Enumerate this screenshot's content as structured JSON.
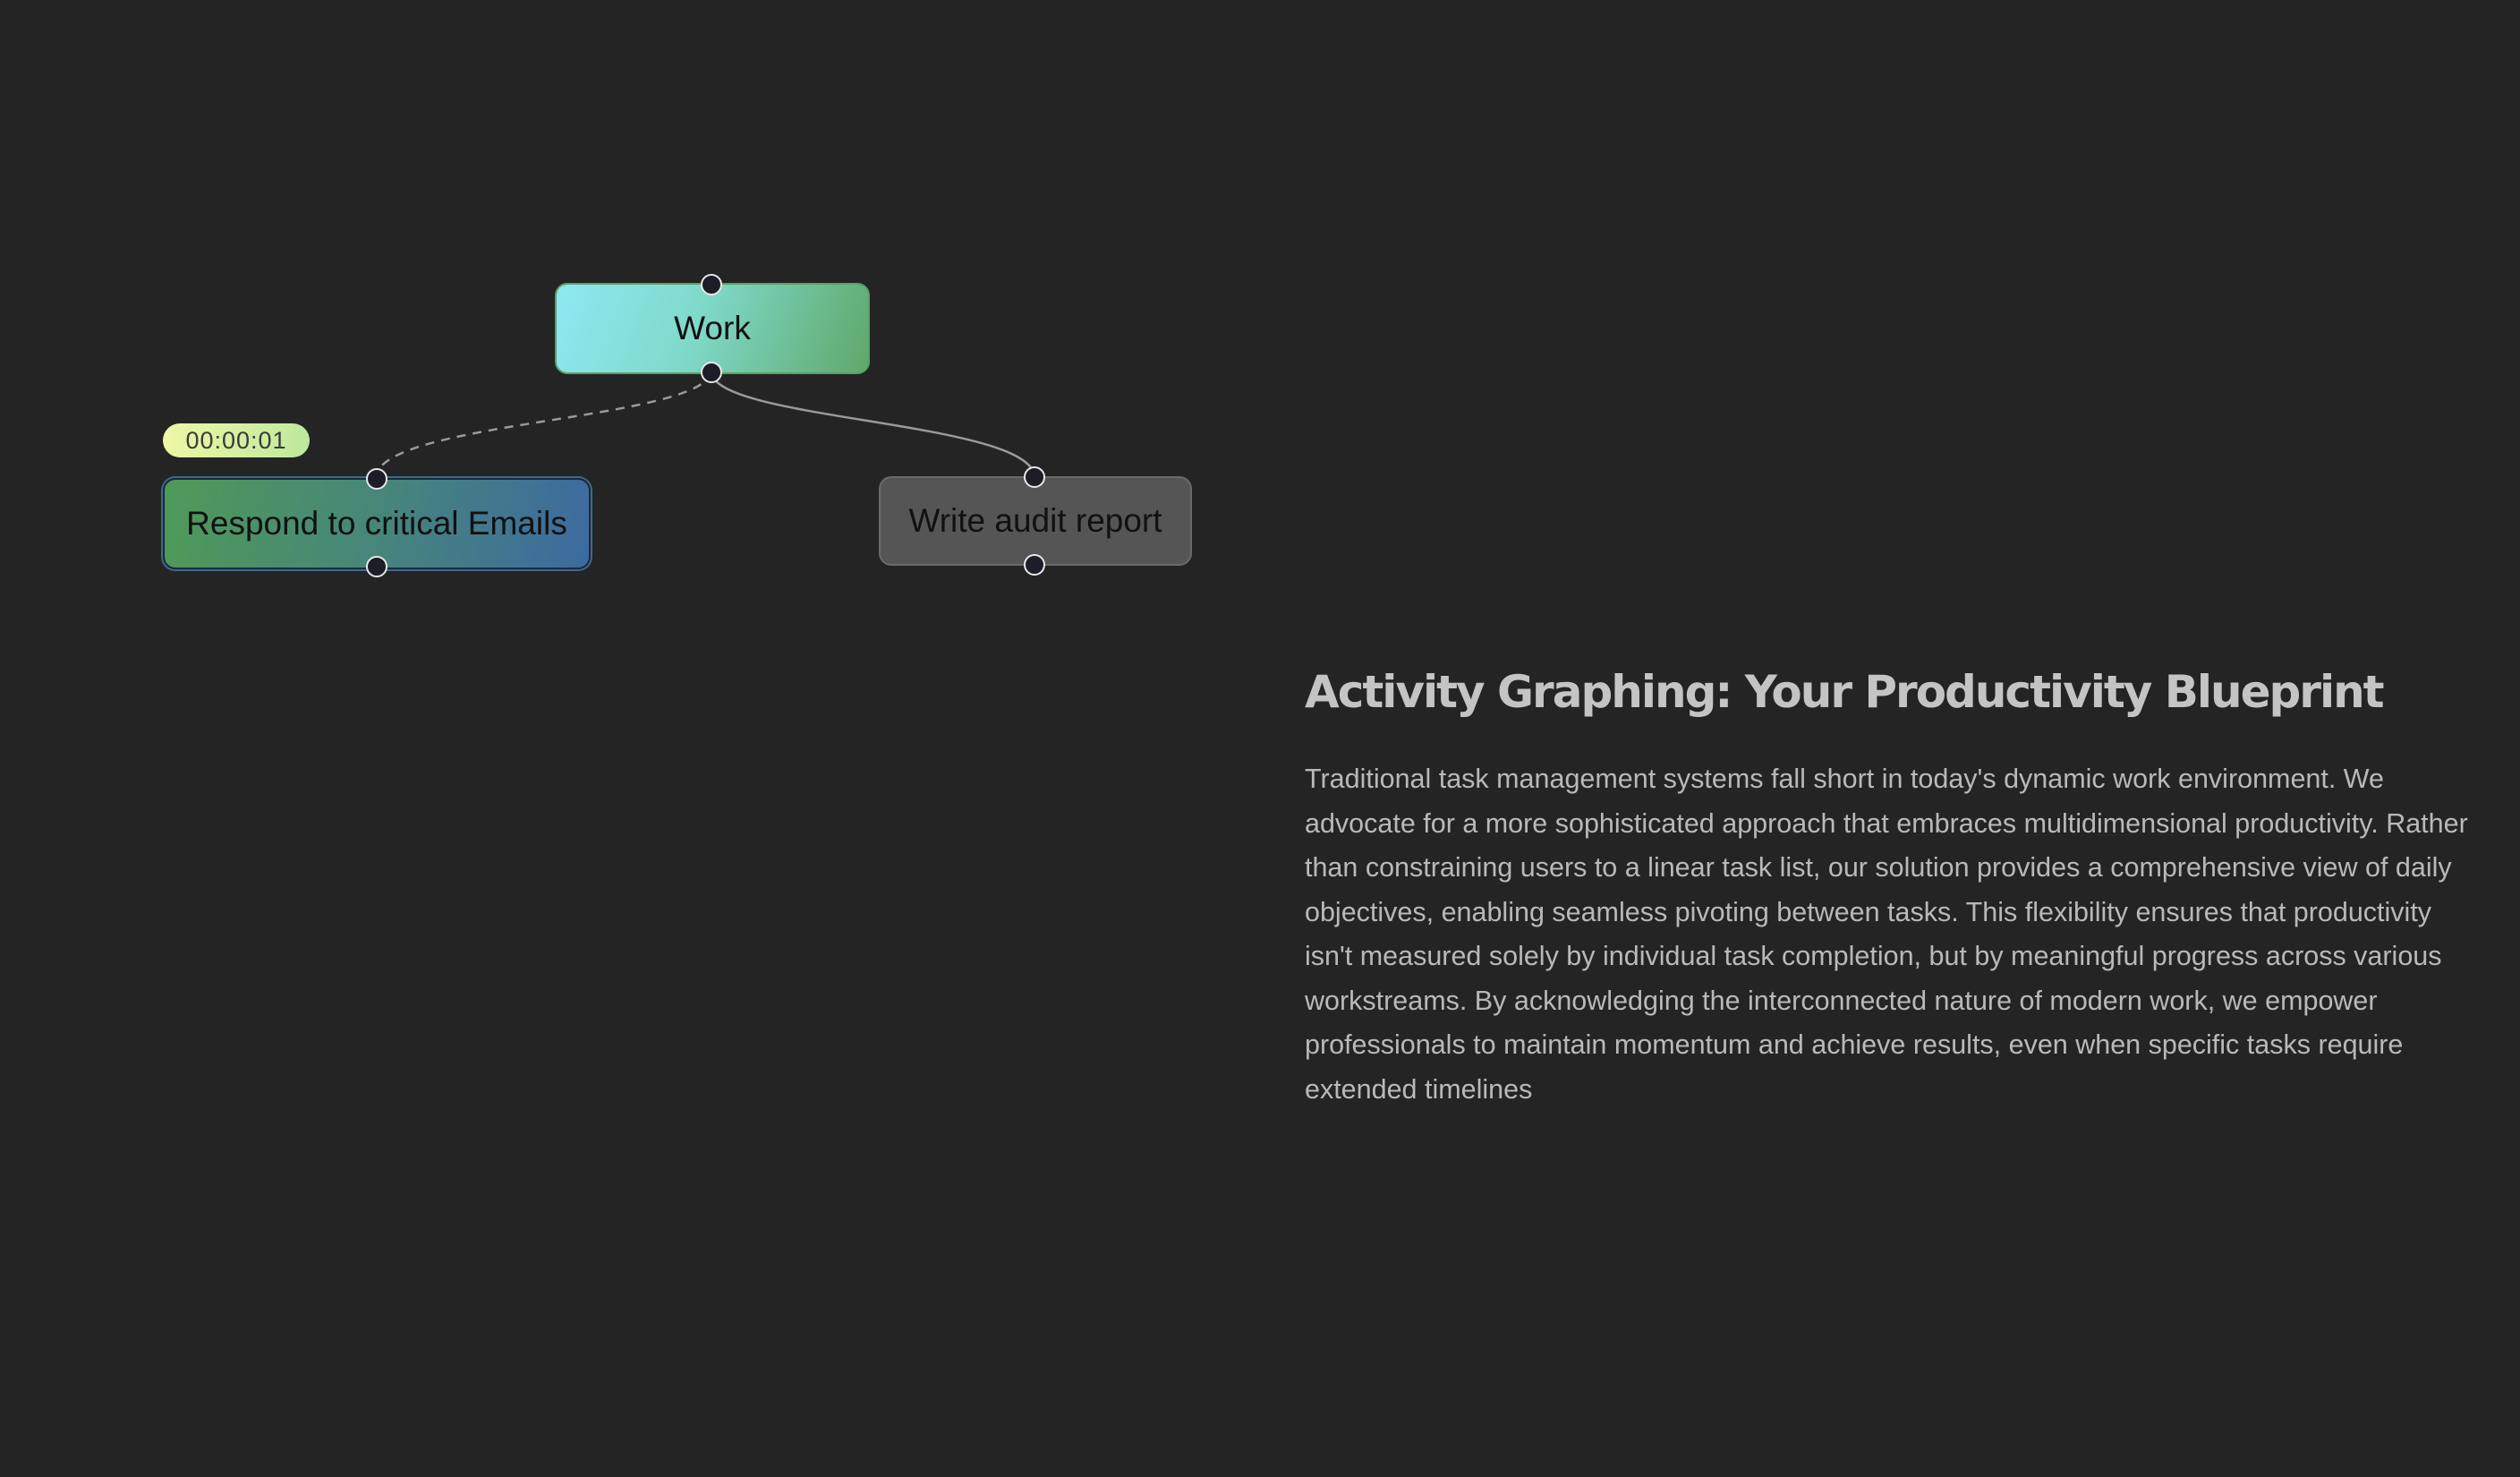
{
  "graph": {
    "nodes": {
      "work": {
        "label": "Work"
      },
      "emails": {
        "label": "Respond to critical Emails",
        "timer": "00:00:01"
      },
      "audit": {
        "label": "Write audit report"
      }
    },
    "edges": [
      {
        "from": "work",
        "to": "emails",
        "style": "dashed"
      },
      {
        "from": "work",
        "to": "audit",
        "style": "solid"
      }
    ]
  },
  "info": {
    "title": "Activity Graphing: Your Productivity Blueprint",
    "body": "Traditional task management systems fall short in today's dynamic work environment. We advocate for a more sophisticated approach that embraces multidimensional productivity. Rather than constraining users to a linear task list, our solution provides a comprehensive view of daily objectives, enabling seamless pivoting between tasks. This flexibility ensures that productivity isn't measured solely by individual task completion, but by meaningful progress across various workstreams. By acknowledging the interconnected nature of modern work, we empower professionals to maintain momentum and achieve results, even when specific tasks require extended timelines"
  },
  "colors": {
    "background": "#242424",
    "edge": "#9a9a9a"
  }
}
